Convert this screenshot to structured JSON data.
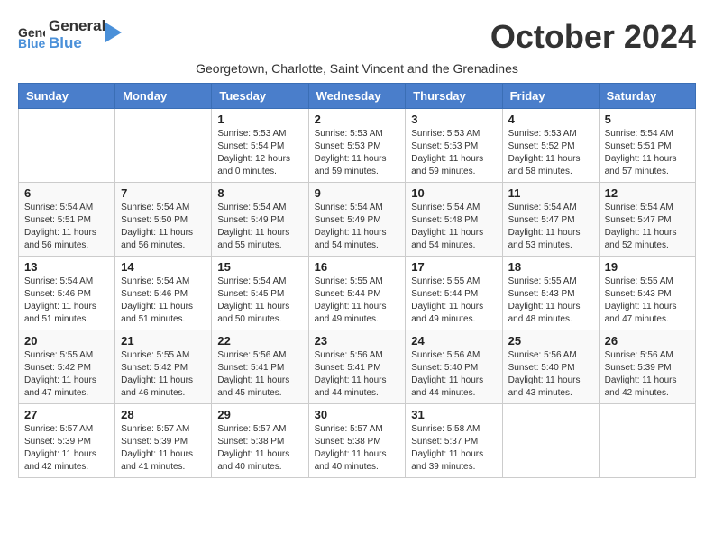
{
  "header": {
    "logo_general": "General",
    "logo_blue": "Blue",
    "month_title": "October 2024",
    "subtitle": "Georgetown, Charlotte, Saint Vincent and the Grenadines"
  },
  "weekdays": [
    "Sunday",
    "Monday",
    "Tuesday",
    "Wednesday",
    "Thursday",
    "Friday",
    "Saturday"
  ],
  "weeks": [
    [
      {
        "day": "",
        "info": ""
      },
      {
        "day": "",
        "info": ""
      },
      {
        "day": "1",
        "info": "Sunrise: 5:53 AM\nSunset: 5:54 PM\nDaylight: 12 hours\nand 0 minutes."
      },
      {
        "day": "2",
        "info": "Sunrise: 5:53 AM\nSunset: 5:53 PM\nDaylight: 11 hours\nand 59 minutes."
      },
      {
        "day": "3",
        "info": "Sunrise: 5:53 AM\nSunset: 5:53 PM\nDaylight: 11 hours\nand 59 minutes."
      },
      {
        "day": "4",
        "info": "Sunrise: 5:53 AM\nSunset: 5:52 PM\nDaylight: 11 hours\nand 58 minutes."
      },
      {
        "day": "5",
        "info": "Sunrise: 5:54 AM\nSunset: 5:51 PM\nDaylight: 11 hours\nand 57 minutes."
      }
    ],
    [
      {
        "day": "6",
        "info": "Sunrise: 5:54 AM\nSunset: 5:51 PM\nDaylight: 11 hours\nand 56 minutes."
      },
      {
        "day": "7",
        "info": "Sunrise: 5:54 AM\nSunset: 5:50 PM\nDaylight: 11 hours\nand 56 minutes."
      },
      {
        "day": "8",
        "info": "Sunrise: 5:54 AM\nSunset: 5:49 PM\nDaylight: 11 hours\nand 55 minutes."
      },
      {
        "day": "9",
        "info": "Sunrise: 5:54 AM\nSunset: 5:49 PM\nDaylight: 11 hours\nand 54 minutes."
      },
      {
        "day": "10",
        "info": "Sunrise: 5:54 AM\nSunset: 5:48 PM\nDaylight: 11 hours\nand 54 minutes."
      },
      {
        "day": "11",
        "info": "Sunrise: 5:54 AM\nSunset: 5:47 PM\nDaylight: 11 hours\nand 53 minutes."
      },
      {
        "day": "12",
        "info": "Sunrise: 5:54 AM\nSunset: 5:47 PM\nDaylight: 11 hours\nand 52 minutes."
      }
    ],
    [
      {
        "day": "13",
        "info": "Sunrise: 5:54 AM\nSunset: 5:46 PM\nDaylight: 11 hours\nand 51 minutes."
      },
      {
        "day": "14",
        "info": "Sunrise: 5:54 AM\nSunset: 5:46 PM\nDaylight: 11 hours\nand 51 minutes."
      },
      {
        "day": "15",
        "info": "Sunrise: 5:54 AM\nSunset: 5:45 PM\nDaylight: 11 hours\nand 50 minutes."
      },
      {
        "day": "16",
        "info": "Sunrise: 5:55 AM\nSunset: 5:44 PM\nDaylight: 11 hours\nand 49 minutes."
      },
      {
        "day": "17",
        "info": "Sunrise: 5:55 AM\nSunset: 5:44 PM\nDaylight: 11 hours\nand 49 minutes."
      },
      {
        "day": "18",
        "info": "Sunrise: 5:55 AM\nSunset: 5:43 PM\nDaylight: 11 hours\nand 48 minutes."
      },
      {
        "day": "19",
        "info": "Sunrise: 5:55 AM\nSunset: 5:43 PM\nDaylight: 11 hours\nand 47 minutes."
      }
    ],
    [
      {
        "day": "20",
        "info": "Sunrise: 5:55 AM\nSunset: 5:42 PM\nDaylight: 11 hours\nand 47 minutes."
      },
      {
        "day": "21",
        "info": "Sunrise: 5:55 AM\nSunset: 5:42 PM\nDaylight: 11 hours\nand 46 minutes."
      },
      {
        "day": "22",
        "info": "Sunrise: 5:56 AM\nSunset: 5:41 PM\nDaylight: 11 hours\nand 45 minutes."
      },
      {
        "day": "23",
        "info": "Sunrise: 5:56 AM\nSunset: 5:41 PM\nDaylight: 11 hours\nand 44 minutes."
      },
      {
        "day": "24",
        "info": "Sunrise: 5:56 AM\nSunset: 5:40 PM\nDaylight: 11 hours\nand 44 minutes."
      },
      {
        "day": "25",
        "info": "Sunrise: 5:56 AM\nSunset: 5:40 PM\nDaylight: 11 hours\nand 43 minutes."
      },
      {
        "day": "26",
        "info": "Sunrise: 5:56 AM\nSunset: 5:39 PM\nDaylight: 11 hours\nand 42 minutes."
      }
    ],
    [
      {
        "day": "27",
        "info": "Sunrise: 5:57 AM\nSunset: 5:39 PM\nDaylight: 11 hours\nand 42 minutes."
      },
      {
        "day": "28",
        "info": "Sunrise: 5:57 AM\nSunset: 5:39 PM\nDaylight: 11 hours\nand 41 minutes."
      },
      {
        "day": "29",
        "info": "Sunrise: 5:57 AM\nSunset: 5:38 PM\nDaylight: 11 hours\nand 40 minutes."
      },
      {
        "day": "30",
        "info": "Sunrise: 5:57 AM\nSunset: 5:38 PM\nDaylight: 11 hours\nand 40 minutes."
      },
      {
        "day": "31",
        "info": "Sunrise: 5:58 AM\nSunset: 5:37 PM\nDaylight: 11 hours\nand 39 minutes."
      },
      {
        "day": "",
        "info": ""
      },
      {
        "day": "",
        "info": ""
      }
    ]
  ]
}
